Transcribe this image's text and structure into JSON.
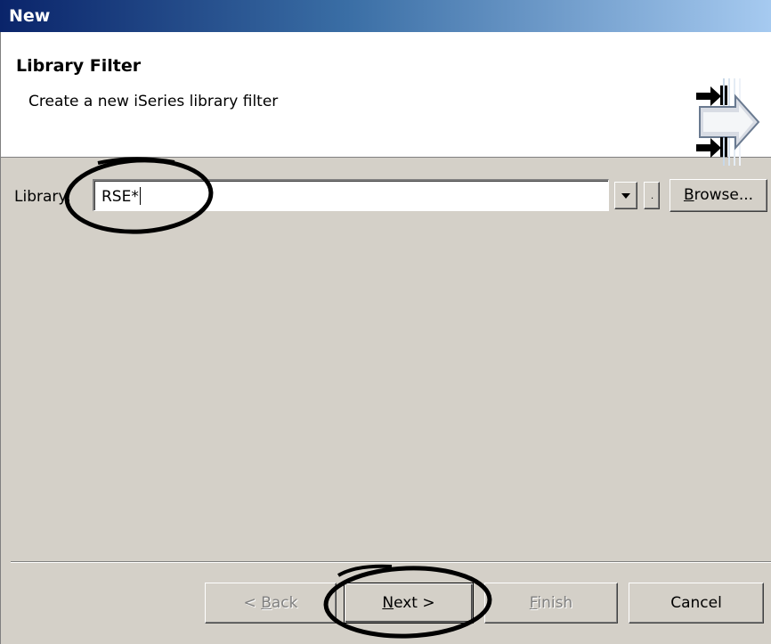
{
  "window": {
    "title": "New"
  },
  "header": {
    "heading": "Library Filter",
    "description": "Create a new iSeries library filter",
    "icon": "wizard-arrows-icon"
  },
  "form": {
    "library_label": "Library:",
    "library_value": "RSE*",
    "browse_label_underlined": "B",
    "browse_label_rest": "rowse..."
  },
  "buttons": {
    "back_prefix": "< ",
    "back_underlined": "B",
    "back_rest": "ack",
    "next_underlined": "N",
    "next_rest": "ext >",
    "finish_underlined": "F",
    "finish_rest": "inish",
    "cancel": "Cancel",
    "back_enabled": false,
    "finish_enabled": false
  },
  "colors": {
    "title_gradient_start": "#0a246a",
    "title_gradient_end": "#a6caf0",
    "dialog_bg": "#d4d0c8",
    "annotation": "#000000"
  },
  "annotations": [
    "circle-around-library-field",
    "circle-around-next-button"
  ]
}
